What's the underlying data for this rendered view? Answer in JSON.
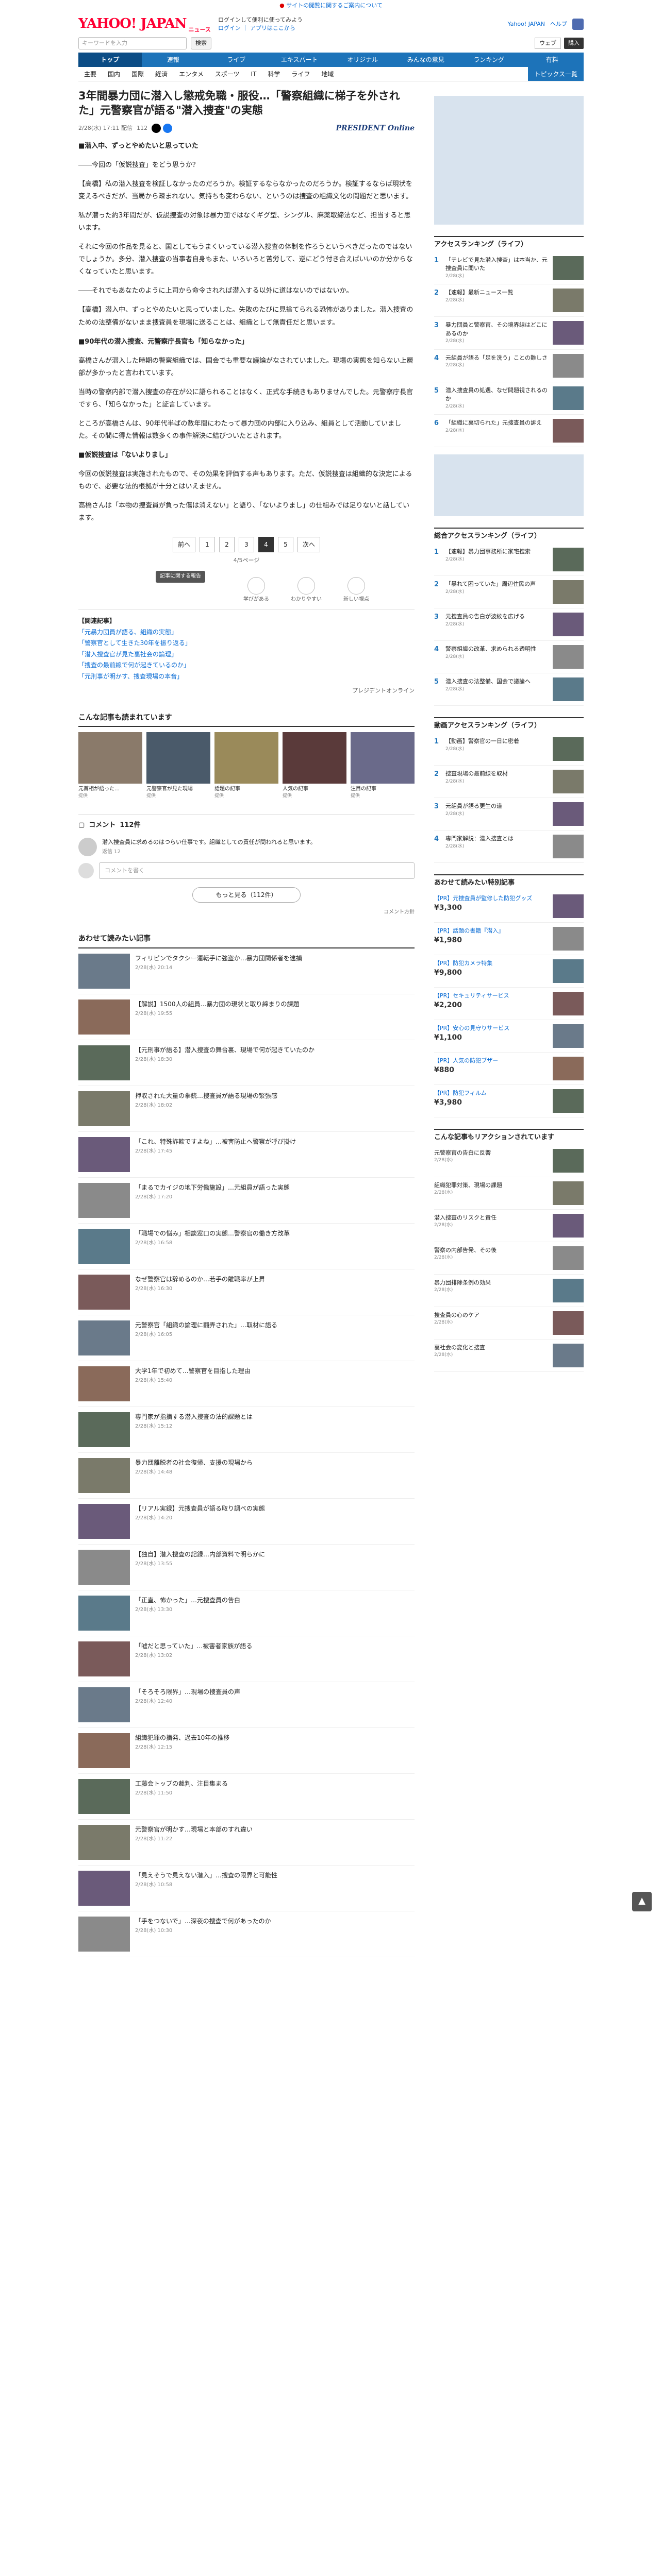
{
  "top": {
    "notice": "サイトの閲覧に関するご案内について"
  },
  "header": {
    "logo": "YAHOO! JAPAN",
    "logo_sub": "ニュース",
    "line1": "ログインして便利に使ってみよう",
    "line2": "ログイン",
    "line3": "アプリはここから",
    "links": [
      "Yahoo! JAPAN",
      "ヘルプ"
    ]
  },
  "search": {
    "placeholder": "キーワードを入力",
    "button": "検索",
    "search_news": "ウェブ",
    "search_web": "ニュース",
    "btn": "購入"
  },
  "nav1": [
    "トップ",
    "速報",
    "ライブ",
    "エキスパート",
    "オリジナル",
    "みんなの意見",
    "ランキング",
    "有料"
  ],
  "nav2": [
    "主要",
    "国内",
    "国際",
    "経済",
    "エンタメ",
    "スポーツ",
    "IT",
    "科学",
    "ライフ",
    "地域"
  ],
  "nav2_more": "トピックス一覧",
  "article": {
    "title": "3年間暴力団に潜入し懲戒免職・服役…「警察組織に梯子を外された」元警察官が語る\"潜入捜査\"の実態",
    "date": "2/28(水) 17:11 配信",
    "comments": "112",
    "publisher": "PRESIDENT Online",
    "paragraphs": [
      "■潜入中、ずっとやめたいと思っていた",
      "――今回の「仮説捜査」をどう思うか？",
      "【高橋】私の潜入捜査を検証しなかったのだろうか。検証するならなかったのだろうか。検証するならば現状を変えるべきだが、当局から疎まれない。気持ちも変わらない、というのは捜査の組織文化の問題だと思います。",
      "私が潜った約3年間だが、仮説捜査の対象は暴力団ではなくギグ型、シングル、麻薬取締法など、担当すると思います。",
      "それに今回の作品を見ると、国としてもうまくいっている潜入捜査の体制を作ろうというべきだったのではないでしょうか。多分、潜入捜査の当事者自身もまた、いろいろと苦労して、逆にどう付き合えばいいのか分からなくなっていたと思います。",
      "――それでもあなたのように上司から命令されれば潜入する以外に道はないのではないか。",
      "【高橋】潜入中、ずっとやめたいと思っていました。失敗のたびに見捨てられる恐怖がありました。潜入捜査のための法整備がないまま捜査員を現場に送ることは、組織として無責任だと思います。",
      "■90年代の潜入捜査、元警察庁長官も「知らなかった」",
      "高橋さんが潜入した時期の警察組織では、国会でも重要な議論がなされていました。現場の実態を知らない上層部が多かったと言われています。",
      "当時の警察内部で潜入捜査の存在が公に語られることはなく、正式な手続きもありませんでした。元警察庁長官ですら、「知らなかった」と証言しています。",
      "ところが高橋さんは、90年代半ばの数年間にわたって暴力団の内部に入り込み、組員として活動していました。その間に得た情報は数多くの事件解決に結びついたとされます。",
      "■仮説捜査は「ないよりまし」",
      "今回の仮説捜査は実施されたもので、その効果を評価する声もあります。ただ、仮説捜査は組織的な決定によるもので、必要な法的根拠が十分とはいえません。",
      "高橋さんは「本物の捜査員が負った傷は消えない」と語り、「ないよりまし」の仕組みでは足りないと話しています。"
    ],
    "pager": [
      "前へ",
      "1",
      "2",
      "3",
      "4",
      "5",
      "次へ"
    ],
    "pager_active": "4",
    "pager_note": "4/5ページ",
    "reactions": [
      "学びがある",
      "わかりやすい",
      "新しい視点"
    ],
    "tip_text": "記事に関する報告",
    "related_head": "【関連記事】",
    "related": [
      "「元暴力団員が語る、組織の実態」",
      "「警察官として生きた30年を振り返る」",
      "「潜入捜査官が見た裏社会の論理」",
      "「捜査の最前線で何が起きているのか」",
      "「元刑事が明かす、捜査現場の本音」"
    ],
    "credit": "プレジデントオンライン"
  },
  "recommend_title": "こんな記事も読まれています",
  "thumbs": [
    {
      "text": "元首相が語った…",
      "src": "提供"
    },
    {
      "text": "元警察官が見た現場",
      "src": "提供"
    },
    {
      "text": "話題の記事",
      "src": "提供"
    },
    {
      "text": "人気の記事",
      "src": "提供"
    },
    {
      "text": "注目の記事",
      "src": "提供"
    }
  ],
  "comments": {
    "title": "コメント",
    "count": "112件",
    "first": "潜入捜査員に求めるのはつらい仕事です。組織としての責任が問われると思います。",
    "first_stats": "返信 12",
    "placeholder": "コメントを書く",
    "more": "もっと見る（112件）",
    "check": "コメント方針"
  },
  "recent_title": "あわせて読みたい記事",
  "recent": [
    {
      "text": "フィリピンでタクシー運転手に強盗か…暴力団関係者を逮捕",
      "src": "2/28(水) 20:14"
    },
    {
      "text": "【解説】1500人の組員…暴力団の現状と取り締まりの課題",
      "src": "2/28(水) 19:55"
    },
    {
      "text": "【元刑事が語る】潜入捜査の舞台裏、現場で何が起きていたのか",
      "src": "2/28(水) 18:30"
    },
    {
      "text": "押収された大量の拳銃…捜査員が語る現場の緊張感",
      "src": "2/28(水) 18:02"
    },
    {
      "text": "「これ、特殊詐欺ですよね」…被害防止へ警察が呼び掛け",
      "src": "2/28(水) 17:45"
    },
    {
      "text": "「まるでカイジの地下労働施設」…元組員が語った実態",
      "src": "2/28(水) 17:20"
    },
    {
      "text": "「職場での悩み」相談窓口の実態…警察官の働き方改革",
      "src": "2/28(水) 16:58"
    },
    {
      "text": "なぜ警察官は辞めるのか…若手の離職率が上昇",
      "src": "2/28(水) 16:30"
    },
    {
      "text": "元警察官「組織の論理に翻弄された」…取材に語る",
      "src": "2/28(水) 16:05"
    },
    {
      "text": "大学1年で初めて…警察官を目指した理由",
      "src": "2/28(水) 15:40"
    },
    {
      "text": "専門家が指摘する潜入捜査の法的課題とは",
      "src": "2/28(水) 15:12"
    },
    {
      "text": "暴力団離脱者の社会復帰、支援の現場から",
      "src": "2/28(水) 14:48"
    },
    {
      "text": "【リアル実録】元捜査員が語る取り調べの実態",
      "src": "2/28(水) 14:20"
    },
    {
      "text": "【独自】潜入捜査の記録…内部資料で明らかに",
      "src": "2/28(水) 13:55"
    },
    {
      "text": "「正直、怖かった」…元捜査員の告白",
      "src": "2/28(水) 13:30"
    },
    {
      "text": "「嘘だと思っていた」…被害者家族が語る",
      "src": "2/28(水) 13:02"
    },
    {
      "text": "「そろそろ限界」…現場の捜査員の声",
      "src": "2/28(水) 12:40"
    },
    {
      "text": "組織犯罪の摘発、過去10年の推移",
      "src": "2/28(水) 12:15"
    },
    {
      "text": "工藤会トップの裁判、注目集まる",
      "src": "2/28(水) 11:50"
    },
    {
      "text": "元警察官が明かす…現場と本部のすれ違い",
      "src": "2/28(水) 11:22"
    },
    {
      "text": "「見えそうで見えない潜入」…捜査の限界と可能性",
      "src": "2/28(水) 10:58"
    },
    {
      "text": "「手をつないで」…深夜の捜査で何があったのか",
      "src": "2/28(水) 10:30"
    }
  ],
  "side": {
    "access_title": "アクセスランキング（ライフ）",
    "access": [
      {
        "n": "1",
        "text": "「テレビで見た潜入捜査」は本当か、元捜査員に聞いた",
        "src": "2/28(水)"
      },
      {
        "text": "【速報】最新ニュース一覧",
        "n": "2",
        "src": "2/28(水)"
      },
      {
        "n": "3",
        "text": "暴力団員と警察官、その境界線はどこにあるのか",
        "src": "2/28(水)"
      },
      {
        "n": "4",
        "text": "元組員が語る「足を洗う」ことの難しさ",
        "src": "2/28(水)"
      },
      {
        "n": "5",
        "text": "潜入捜査員の処遇、なぜ問題視されるのか",
        "src": "2/28(水)"
      },
      {
        "n": "6",
        "text": "「組織に裏切られた」元捜査員の訴え",
        "src": "2/28(水)"
      }
    ],
    "ranking2_title": "総合アクセスランキング（ライフ）",
    "ranking2": [
      {
        "n": "1",
        "text": "【速報】暴力団事務所に家宅捜索",
        "src": "2/28(水)"
      },
      {
        "n": "2",
        "text": "「暴れて困っていた」周辺住民の声",
        "src": "2/28(水)"
      },
      {
        "n": "3",
        "text": "元捜査員の告白が波紋を広げる",
        "src": "2/28(水)"
      },
      {
        "n": "4",
        "text": "警察組織の改革、求められる透明性",
        "src": "2/28(水)"
      },
      {
        "n": "5",
        "text": "潜入捜査の法整備、国会で議論へ",
        "src": "2/28(水)"
      }
    ],
    "ranking3_title": "動画アクセスランキング（ライフ）",
    "ranking3": [
      {
        "n": "1",
        "text": "【動画】警察官の一日に密着",
        "src": "2/28(水)"
      },
      {
        "n": "2",
        "text": "捜査現場の最前線を取材",
        "src": "2/28(水)"
      },
      {
        "n": "3",
        "text": "元組員が語る更生の道",
        "src": "2/28(水)"
      },
      {
        "n": "4",
        "text": "専門家解説：潜入捜査とは",
        "src": "2/28(水)"
      }
    ],
    "pr_title": "あわせて読みたい特別記事",
    "pr": [
      {
        "text": "【PR】元捜査員が監修した防犯グッズ",
        "price": "¥3,300"
      },
      {
        "text": "【PR】話題の書籍『潜入』",
        "price": "¥1,980"
      },
      {
        "text": "【PR】防犯カメラ特集",
        "price": "¥9,800"
      },
      {
        "text": "【PR】セキュリティサービス",
        "price": "¥2,200"
      },
      {
        "text": "【PR】安心の見守りサービス",
        "price": "¥1,100"
      },
      {
        "text": "【PR】人気の防犯ブザー",
        "price": "¥880"
      },
      {
        "text": "【PR】防犯フィルム",
        "price": "¥3,980"
      }
    ],
    "comment_rank_title": "こんな記事もリアクションされています",
    "comment_rank": [
      {
        "text": "元警察官の告白に反響",
        "src": "2/28(水)"
      },
      {
        "text": "組織犯罪対策、現場の課題",
        "src": "2/28(水)"
      },
      {
        "text": "潜入捜査のリスクと責任",
        "src": "2/28(水)"
      },
      {
        "text": "警察の内部告発、その後",
        "src": "2/28(水)"
      },
      {
        "text": "暴力団排除条例の効果",
        "src": "2/28(水)"
      },
      {
        "text": "捜査員の心のケア",
        "src": "2/28(水)"
      },
      {
        "text": "裏社会の変化と捜査",
        "src": "2/28(水)"
      }
    ]
  },
  "colors": {
    "brand": "#ff0033",
    "nav": "#1d73b9",
    "link": "#0b6cd4"
  }
}
